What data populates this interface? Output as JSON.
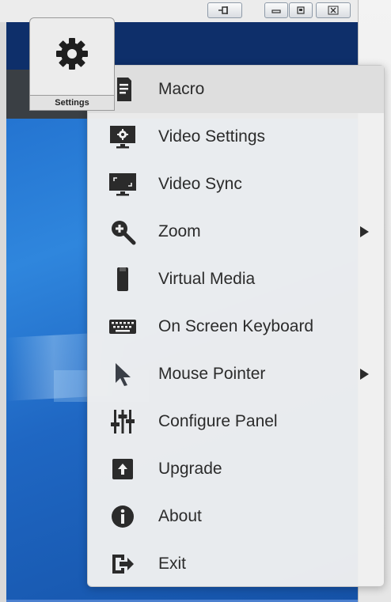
{
  "settings_button": {
    "label": "Settings"
  },
  "menu": {
    "items": [
      {
        "label": "Macro",
        "icon": "macro-icon",
        "submenu": false
      },
      {
        "label": "Video Settings",
        "icon": "video-settings-icon",
        "submenu": false
      },
      {
        "label": "Video Sync",
        "icon": "video-sync-icon",
        "submenu": false
      },
      {
        "label": "Zoom",
        "icon": "zoom-icon",
        "submenu": true
      },
      {
        "label": "Virtual Media",
        "icon": "virtual-media-icon",
        "submenu": false
      },
      {
        "label": "On Screen Keyboard",
        "icon": "keyboard-icon",
        "submenu": false
      },
      {
        "label": "Mouse Pointer",
        "icon": "mouse-pointer-icon",
        "submenu": true
      },
      {
        "label": "Configure Panel",
        "icon": "configure-panel-icon",
        "submenu": false
      },
      {
        "label": "Upgrade",
        "icon": "upgrade-icon",
        "submenu": false
      },
      {
        "label": "About",
        "icon": "about-icon",
        "submenu": false
      },
      {
        "label": "Exit",
        "icon": "exit-icon",
        "submenu": false
      }
    ]
  },
  "colors": {
    "icon": "#2b2b2b",
    "highlight": "#dedede",
    "menu_bg": "#f0f0f0"
  }
}
